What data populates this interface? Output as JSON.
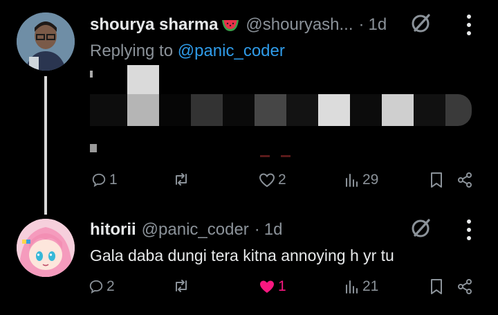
{
  "post1": {
    "display_name": "shourya sharma",
    "name_emoji_icon": "watermelon-icon",
    "handle": "@shouryash...",
    "separator": "·",
    "time": "1d",
    "replying_prefix": "Replying to",
    "replying_mention": "@panic_coder",
    "counts": {
      "replies": "1",
      "likes": "2",
      "views": "29"
    }
  },
  "post2": {
    "display_name": "hitorii",
    "handle": "@panic_coder",
    "separator": "·",
    "time": "1d",
    "text": "Gala daba dungi tera kitna annoying h yr tu",
    "counts": {
      "replies": "2",
      "likes": "1",
      "views": "21"
    },
    "liked": true
  },
  "colors": {
    "background": "#000000",
    "text": "#e7e9ea",
    "muted": "#8b9299",
    "link": "#2f9be8",
    "like_active": "#f91880",
    "thread_line": "#d9d9d9"
  },
  "icons": [
    "reply-icon",
    "repost-icon",
    "like-icon",
    "views-icon",
    "bookmark-icon",
    "share-icon",
    "grok-icon",
    "more-icon"
  ]
}
